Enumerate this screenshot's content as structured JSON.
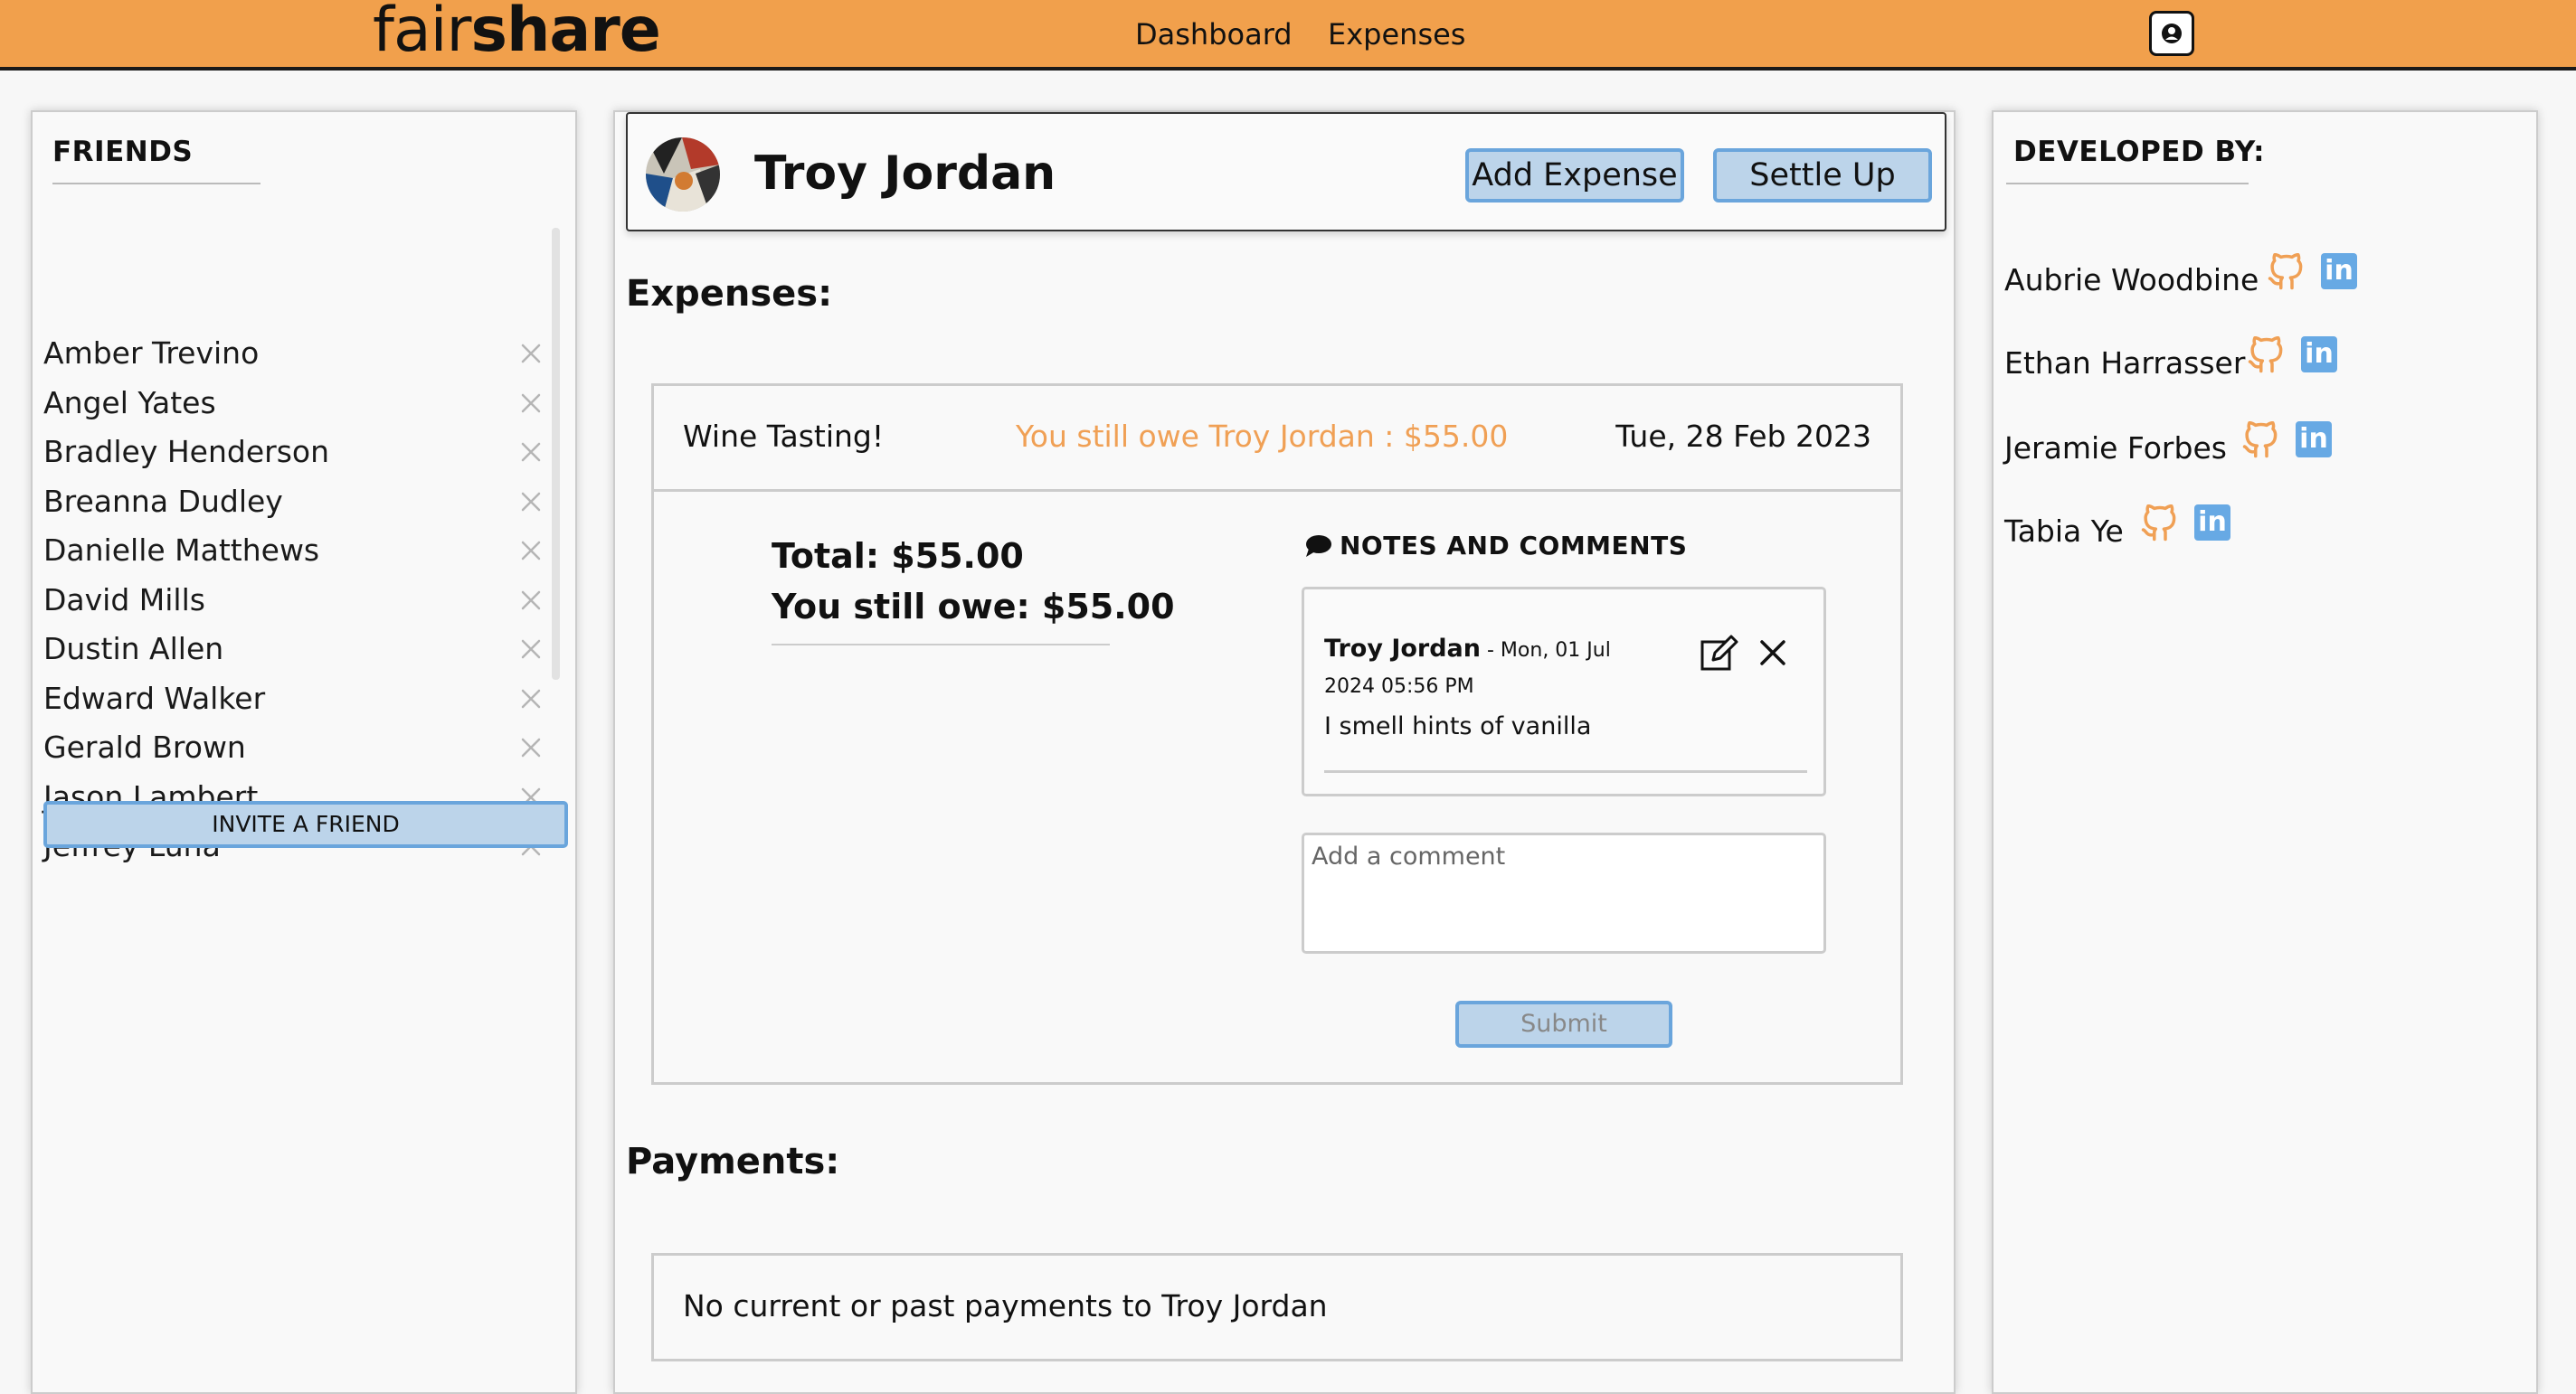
{
  "app": {
    "logo_part1": "fair",
    "logo_part2": "share",
    "nav": [
      "Dashboard",
      "Expenses"
    ],
    "user_button_icon": "user-icon"
  },
  "friends": {
    "title": "FRIENDS",
    "items": [
      "Amber Trevino",
      "Angel Yates",
      "Bradley Henderson",
      "Breanna Dudley",
      "Danielle Matthews",
      "David Mills",
      "Dustin Allen",
      "Edward Walker",
      "Gerald Brown",
      "Jason Lambert",
      "Jeffrey Luna"
    ],
    "remove_icon": "close-icon",
    "invite_label": "INVITE A FRIEND"
  },
  "friend_view": {
    "name": "Troy Jordan",
    "add_expense_label": "Add Expense",
    "settle_up_label": "Settle Up",
    "expenses_heading": "Expenses:",
    "expense": {
      "description": "Wine Tasting!",
      "owe_text": "You still owe Troy Jordan : $55.00",
      "date": "Tue, 28 Feb 2023",
      "total": "Total: $55.00",
      "still_owe": "You still owe: $55.00",
      "notes_title": "NOTES AND COMMENTS",
      "comment": {
        "author": "Troy Jordan",
        "meta": "- Mon, 01 Jul 2024 05:56 PM",
        "text": "I smell hints of vanilla"
      },
      "comment_placeholder": "Add a comment",
      "submit_label": "Submit"
    },
    "payments_heading": "Payments:",
    "payments_empty": "No current or past payments to Troy Jordan"
  },
  "developers": {
    "title": "DEVELOPED BY:",
    "items": [
      "Aubrie Woodbine",
      "Ethan Harrasser",
      "Jeramie Forbes",
      "Tabia Ye"
    ],
    "github_icon": "github-icon",
    "linkedin_label": "in"
  },
  "colors": {
    "accent": "#f1a04c",
    "button_fill": "#bcd4ea",
    "button_border": "#6aa5dc",
    "owe_text": "#f0a055",
    "linkedin": "#67a9e4"
  }
}
